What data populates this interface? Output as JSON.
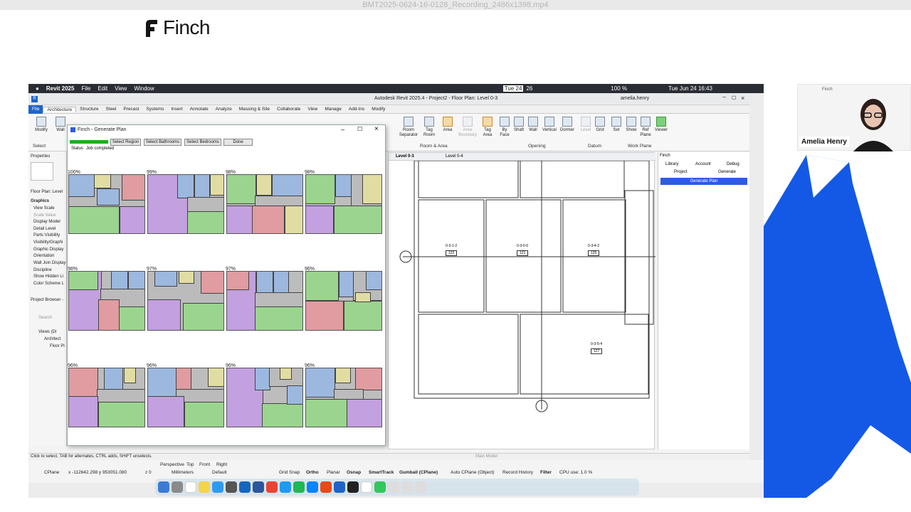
{
  "recording_title": "BMT2025-0624-16-0128_Recording_2486x1398.mp4",
  "brand": {
    "name": "Finch"
  },
  "webcam": {
    "name": "Amelia Henry",
    "brand": "Finch"
  },
  "mac_menubar": {
    "app": "Revit 2025",
    "items": [
      "File",
      "Edit",
      "View",
      "Window"
    ],
    "date": "Tue 24",
    "day_num": "26",
    "battery": "100 %",
    "clock": "Tue Jun 24  16:43"
  },
  "revit": {
    "window_title": "Autodesk Revit 2025.4 - Project2 - Floor Plan: Level 0-3",
    "user": "amelia.henry",
    "tabs": [
      "File",
      "Architecture",
      "Structure",
      "Steel",
      "Precast",
      "Systems",
      "Insert",
      "Annotate",
      "Analyze",
      "Massing & Site",
      "Collaborate",
      "View",
      "Manage",
      "Add-Ins",
      "Modify"
    ],
    "ribbon_left": [
      {
        "label": "Modify"
      },
      {
        "label": "Wall"
      }
    ],
    "ribbon_room": [
      {
        "label": "Room Separator"
      },
      {
        "label": "Tag Room"
      },
      {
        "label": "Area"
      },
      {
        "label": "Area Boundary"
      },
      {
        "label": "Tag Area"
      }
    ],
    "ribbon_opening": [
      {
        "label": "By Face"
      },
      {
        "label": "Shaft"
      },
      {
        "label": "Wall"
      },
      {
        "label": "Vertical"
      },
      {
        "label": "Dormer"
      }
    ],
    "ribbon_datum": [
      {
        "label": "Level"
      },
      {
        "label": "Grid"
      }
    ],
    "ribbon_workplane": [
      {
        "label": "Set"
      },
      {
        "label": "Show"
      },
      {
        "label": "Ref Plane"
      },
      {
        "label": "Viewer"
      }
    ],
    "groups": [
      "Select",
      "Room & Area",
      "Opening",
      "Datum",
      "Work Plane"
    ],
    "properties": {
      "title": "Properties",
      "type": "Floor Plan: Level",
      "section": "Graphics",
      "rows": [
        "View Scale",
        "Scale Value",
        "Display Model",
        "Detail Level",
        "Parts Visibility",
        "Visibility/Graphi",
        "Graphic Display",
        "Orientation",
        "Wall Join Display",
        "Discipline",
        "Show Hidden Li",
        "Color Scheme L"
      ]
    },
    "project_browser": {
      "title": "Project Browser -",
      "search": "Search",
      "tree": [
        "Views (Di",
        "Architect",
        "Floor Pl"
      ]
    },
    "view_tabs": [
      "Level 0-3",
      "Level 0-4"
    ],
    "rooms": [
      {
        "name": "0-3-1-2",
        "num": "122"
      },
      {
        "name": "0-3-0-0",
        "num": "121"
      },
      {
        "name": "0-3-4-2",
        "num": "125"
      },
      {
        "name": "0-3-5-4",
        "num": "127"
      }
    ],
    "finch_pane": {
      "title": "Finch",
      "tabs": [
        "Library",
        "Account",
        "Debug"
      ],
      "subtabs": [
        "Project",
        "Generate"
      ],
      "button": "Generate Plan"
    },
    "status_hint": "Click to select, TAB for alternates, CTRL adds, SHIFT unselects.",
    "main_model": "Main Model"
  },
  "dialog": {
    "title": "Finch - Generate Plan",
    "buttons": [
      "Select Region",
      "Select Bathrooms",
      "Select Bedrooms",
      "Done"
    ],
    "status_label": "Status",
    "status_text": "Job completed",
    "progress": 1.0,
    "scores": [
      "100%",
      "99%",
      "98%",
      "98%",
      "98%",
      "97%",
      "97%",
      "96%",
      "96%",
      "96%",
      "96%",
      "96%"
    ]
  },
  "rhino": {
    "cplane": "CPlane",
    "coords": "x -112642.298   y 953051.080",
    "z": "z 0",
    "units": "Millimeters",
    "layer": "Default",
    "toggles": [
      "Grid Snap",
      "Ortho",
      "Planar",
      "Osnap",
      "SmartTrack",
      "Gumball (CPlane)",
      "Auto CPlane (Object)",
      "Record History",
      "Filter"
    ],
    "cpu": "CPU use: 1.0 %",
    "views": [
      "Perspective",
      "Top",
      "Front",
      "Right"
    ]
  }
}
